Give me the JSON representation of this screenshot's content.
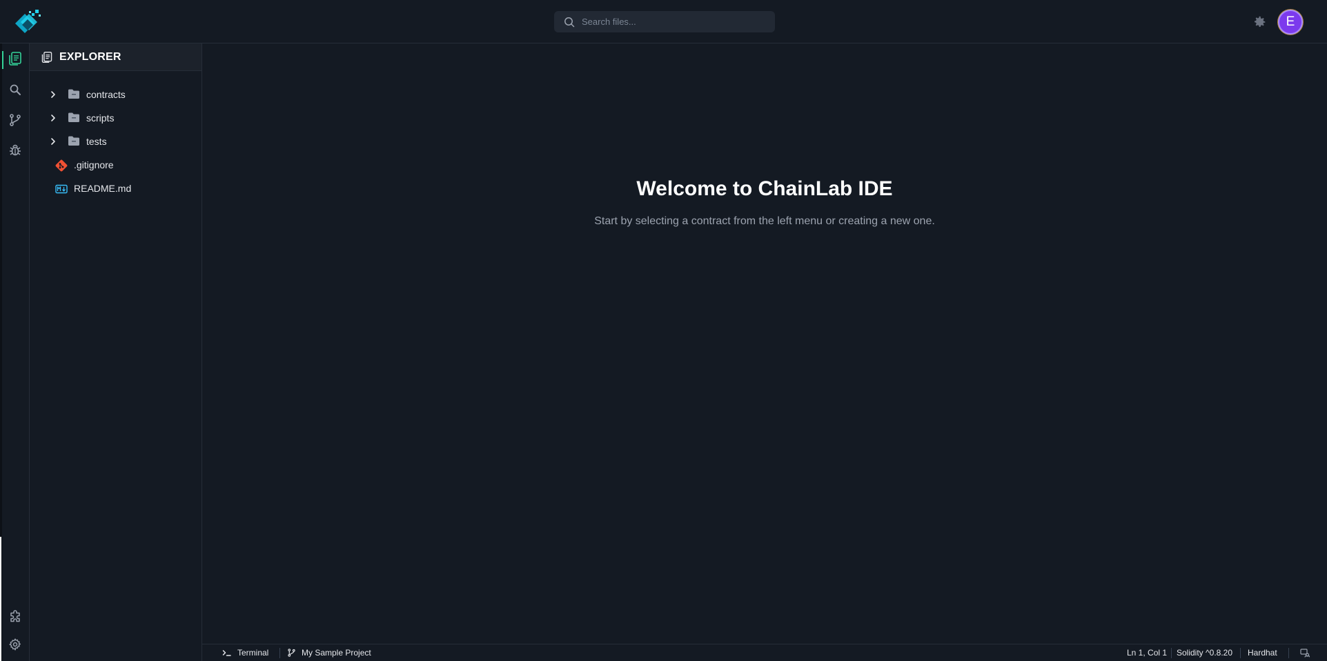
{
  "app": {
    "brand_color": "#22d3ee",
    "accent_color": "#34d399"
  },
  "topbar": {
    "search_placeholder": "Search files...",
    "avatar_initial": "E",
    "avatar_color": "#7c3aed"
  },
  "activitybar": {
    "items": [
      {
        "name": "explorer",
        "icon": "files-icon",
        "active": true
      },
      {
        "name": "search",
        "icon": "search-icon",
        "active": false
      },
      {
        "name": "source-control",
        "icon": "git-branch-icon",
        "active": false
      },
      {
        "name": "debug",
        "icon": "bug-icon",
        "active": false
      }
    ],
    "bottom_items": [
      {
        "name": "extensions",
        "icon": "puzzle-icon"
      },
      {
        "name": "settings",
        "icon": "gear-icon"
      }
    ]
  },
  "sidebar": {
    "title": "EXPLORER",
    "tree": [
      {
        "type": "folder",
        "label": "contracts",
        "expanded": false
      },
      {
        "type": "folder",
        "label": "scripts",
        "expanded": false
      },
      {
        "type": "folder",
        "label": "tests",
        "expanded": false
      },
      {
        "type": "file",
        "label": ".gitignore",
        "icon": "git-icon"
      },
      {
        "type": "file",
        "label": "README.md",
        "icon": "markdown-icon"
      }
    ]
  },
  "main": {
    "welcome_title": "Welcome to ChainLab IDE",
    "welcome_subtitle": "Start by selecting a contract from the left menu or creating a new one."
  },
  "statusbar": {
    "terminal_label": "Terminal",
    "project_label": "My Sample Project",
    "cursor_position": "Ln 1, Col 1",
    "compiler": "Solidity ^0.8.20",
    "framework": "Hardhat"
  }
}
